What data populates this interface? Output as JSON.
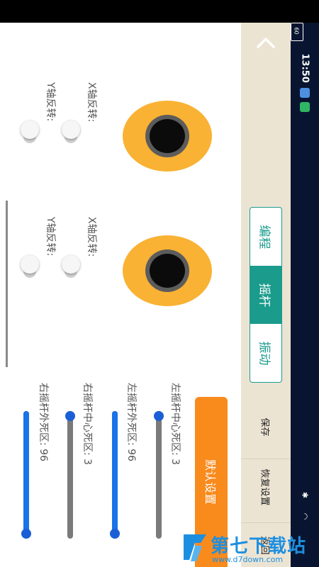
{
  "status_bar": {
    "time": "13:50",
    "battery": "60",
    "bluetooth_icon": "bluetooth-icon",
    "wifi_icon": "wifi-icon"
  },
  "sidebar": {
    "back_icon": "chevron-up-icon",
    "tabs": [
      {
        "label": "编程",
        "active": false
      },
      {
        "label": "摇杆",
        "active": true
      },
      {
        "label": "振动",
        "active": false
      }
    ],
    "buttons": {
      "save": "保存",
      "restore": "恢复设置",
      "back": "返回"
    }
  },
  "left_joystick": {
    "x_invert_label": "X轴反转:",
    "y_invert_label": "Y轴反转:"
  },
  "right_joystick": {
    "x_invert_label": "X轴反转:",
    "y_invert_label": "Y轴反转:"
  },
  "default_button": "默认设置",
  "sliders": [
    {
      "label": "左摇杆中心死区: 3",
      "value": 3,
      "fraction": 0.0
    },
    {
      "label": "左摇杆外死区: 96",
      "value": 96,
      "fraction": 1.0
    },
    {
      "label": "右摇杆中心死区: 3",
      "value": 3,
      "fraction": 0.0
    },
    {
      "label": "右摇杆外死区: 96",
      "value": 96,
      "fraction": 1.0
    }
  ],
  "colors": {
    "accent_teal": "#1a9b8c",
    "joystick_orange": "#f9b233",
    "default_button_orange": "#f98a1c",
    "slider_blue": "#1a73e8",
    "sidebar_beige": "#ece4d3",
    "status_bar_navy": "#091530"
  },
  "watermark": {
    "title": "第七下载站",
    "url": "www.d7down.com"
  }
}
